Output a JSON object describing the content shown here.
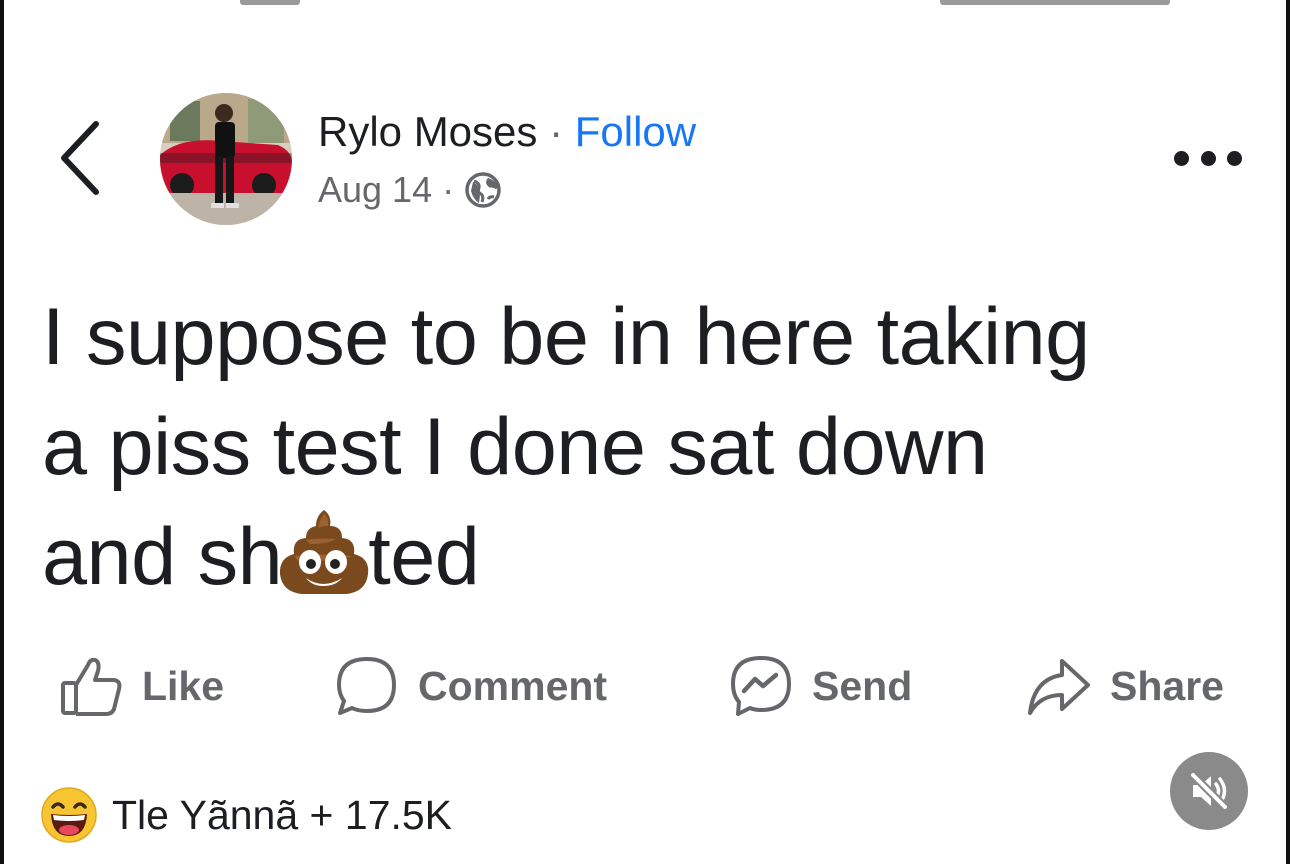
{
  "post": {
    "author": "Rylo Moses",
    "separator": "·",
    "follow_label": "Follow",
    "date": "Aug 14",
    "meta_separator": "·",
    "privacy_icon": "globe-icon",
    "text_line1": "I suppose to be in here taking",
    "text_line2": "a piss test I done sat down",
    "text_line3_start": "and sh",
    "text_line3_end": "ted",
    "inline_emoji": "poop-icon"
  },
  "actions": {
    "like_label": "Like",
    "comment_label": "Comment",
    "send_label": "Send",
    "share_label": "Share"
  },
  "reactions": {
    "summary": "Tle Yãnnã + 17.5K",
    "icon": "laughing-emoji-icon"
  },
  "colors": {
    "accent": "#1877f2",
    "text": "#1c1e21",
    "secondary": "#65676b",
    "mute_bg": "#8a8a8a"
  }
}
